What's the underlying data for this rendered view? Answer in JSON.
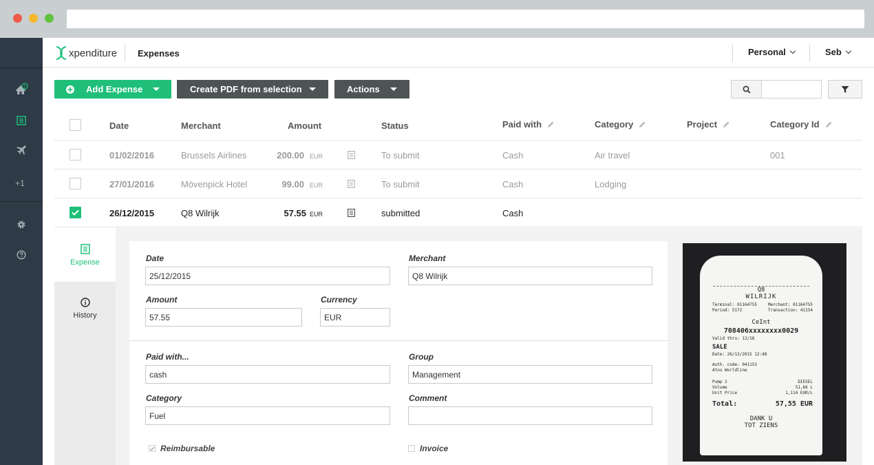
{
  "app": {
    "logo_text": "xpenditure",
    "page_title": "Expenses",
    "account_menu": "Personal",
    "user_menu": "Seb"
  },
  "sidebar": {
    "extra_label": "+1"
  },
  "toolbar": {
    "add_expense": "Add Expense",
    "create_pdf": "Create PDF from selection",
    "actions": "Actions",
    "search_placeholder": ""
  },
  "table": {
    "headers": {
      "date": "Date",
      "merchant": "Merchant",
      "amount": "Amount",
      "status": "Status",
      "paid_with": "Paid with",
      "category": "Category",
      "project": "Project",
      "category_id": "Category Id"
    },
    "rows": [
      {
        "date": "01/02/2016",
        "merchant": "Brussels Airlines",
        "amount": "200.00",
        "currency": "EUR",
        "status": "To submit",
        "paid_with": "Cash",
        "category": "Air travel",
        "project": "",
        "category_id": "001",
        "selected": false
      },
      {
        "date": "27/01/2016",
        "merchant": "Mövenpick Hotel",
        "amount": "99.00",
        "currency": "EUR",
        "status": "To submit",
        "paid_with": "Cash",
        "category": "Lodging",
        "project": "",
        "category_id": "",
        "selected": false
      },
      {
        "date": "26/12/2015",
        "merchant": "Q8 Wilrijk",
        "amount": "57.55",
        "currency": "EUR",
        "status": "submitted",
        "paid_with": "Cash",
        "category": "",
        "project": "",
        "category_id": "",
        "selected": true
      }
    ]
  },
  "detail": {
    "tabs": [
      {
        "label": "Expense",
        "active": true
      },
      {
        "label": "History",
        "active": false
      }
    ],
    "form": {
      "date_label": "Date",
      "date_value": "25/12/2015",
      "merchant_label": "Merchant",
      "merchant_value": "Q8 Wilrijk",
      "amount_label": "Amount",
      "amount_value": "57.55",
      "currency_label": "Currency",
      "currency_value": "EUR",
      "paid_with_label": "Paid with...",
      "paid_with_value": "cash",
      "group_label": "Group",
      "group_value": "Management",
      "category_label": "Category",
      "category_value": "Fuel",
      "comment_label": "Comment",
      "comment_value": "",
      "reimbursable_label": "Reimbursable",
      "reimbursable_checked": true,
      "invoice_label": "Invoice",
      "invoice_checked": false
    },
    "receipt": {
      "title": "Q8",
      "subtitle": "WILRIJK",
      "terminal": "Terminal: 01164755",
      "merchant_no": "Merchant: 01164755",
      "period": "Period: 5172",
      "transaction": "Transaction: 41154",
      "card_brand": "CeInt",
      "card_number": "708406xxxxxxxx0029",
      "valid_thru": "Valid thru: 12/18",
      "sale": "SALE",
      "sale_date": "Date: 26/12/2015 12:48",
      "auth": "Auth. code: 041153",
      "provider": "Atos Worldline",
      "pump": "Pump 2",
      "volume": "Volume",
      "unit_price": "Unit Price",
      "fuel": "DIESEL",
      "volume_val": "51,66 L",
      "unit_price_val": "1,114 EUR/L",
      "total_label": "Total:",
      "total_value": "57,55 EUR",
      "thanks1": "DANK U",
      "thanks2": "TOT ZIENS"
    }
  },
  "colors": {
    "accent": "#1fbf7a",
    "sidebar": "#2e3a46",
    "dark_button": "#4e5356"
  }
}
